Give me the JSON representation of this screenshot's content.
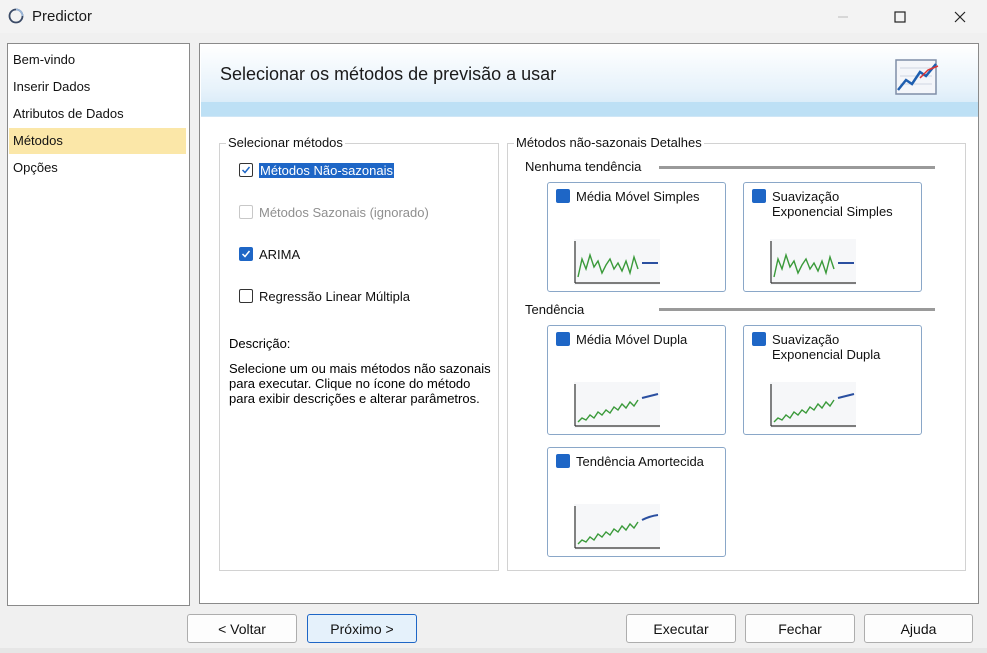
{
  "window": {
    "title": "Predictor"
  },
  "sidebar": {
    "items": [
      {
        "label": "Bem-vindo"
      },
      {
        "label": "Inserir Dados"
      },
      {
        "label": "Atributos de Dados"
      },
      {
        "label": "Métodos",
        "active": true
      },
      {
        "label": "Opções"
      }
    ]
  },
  "header": {
    "title": "Selecionar os métodos de previsão a usar"
  },
  "select_methods": {
    "label": "Selecionar métodos",
    "options": [
      {
        "label": "Métodos Não-sazonais",
        "checked": true,
        "selected": true
      },
      {
        "label": "Métodos Sazonais (ignorado)",
        "checked": false,
        "disabled": true
      },
      {
        "label": "ARIMA",
        "checked": true
      },
      {
        "label": "Regressão Linear Múltipla",
        "checked": false
      }
    ]
  },
  "description": {
    "label": "Descrição:",
    "text": "Selecione um ou mais métodos não sazonais para executar.  Clique no ícone do método para exibir descrições e alterar parâmetros."
  },
  "details": {
    "label": "Métodos não-sazonais Detalhes",
    "no_trend": {
      "label": "Nenhuma tendência",
      "methods": [
        {
          "label": "Média Móvel Simples",
          "checked": true
        },
        {
          "label": "Suavização Exponencial Simples",
          "checked": true
        }
      ]
    },
    "trend": {
      "label": "Tendência",
      "methods": [
        {
          "label": "Média Móvel Dupla",
          "checked": true
        },
        {
          "label": "Suavização Exponencial Dupla",
          "checked": true
        },
        {
          "label": "Tendência Amortecida",
          "checked": true
        }
      ]
    }
  },
  "buttons": {
    "back": "< Voltar",
    "next": "Próximo >",
    "run": "Executar",
    "close": "Fechar",
    "help": "Ajuda"
  },
  "colors": {
    "accent": "#1e66c6",
    "active_nav": "#fbe7a8",
    "chart_line": "#3a9a3a",
    "forecast_line": "#2a4fa0"
  }
}
